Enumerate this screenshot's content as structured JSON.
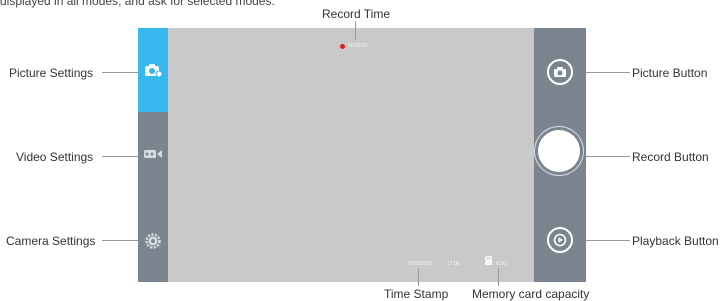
{
  "top_partial_text": "displayed in all modes, and ask for selected modes.",
  "screen": {
    "record_time_value": "00:00:20",
    "date": "2016/09/03",
    "time": "17:06",
    "capacity_value": "8.5G"
  },
  "callouts": {
    "record_time": "Record Time",
    "picture_settings": "Picture Settings",
    "video_settings": "Video Settings",
    "camera_settings": "Camera Settings",
    "picture_button": "Picture Button",
    "record_button": "Record Button",
    "playback_button": "Playback Button",
    "time_stamp": "Time Stamp",
    "memory_card_capacity": "Memory card capacity"
  },
  "colors": {
    "active_tab": "#37b8ee",
    "panel": "#7b858f",
    "screen": "#c8c9c8",
    "record_dot": "#e02020"
  },
  "icons": {
    "picture_settings": "camera-gear-icon",
    "video_settings": "video-camera-icon",
    "camera_settings": "gear-icon",
    "picture_button": "camera-icon",
    "record_button": "record-circle-icon",
    "playback_button": "play-icon",
    "memory_card": "sd-card-icon"
  }
}
